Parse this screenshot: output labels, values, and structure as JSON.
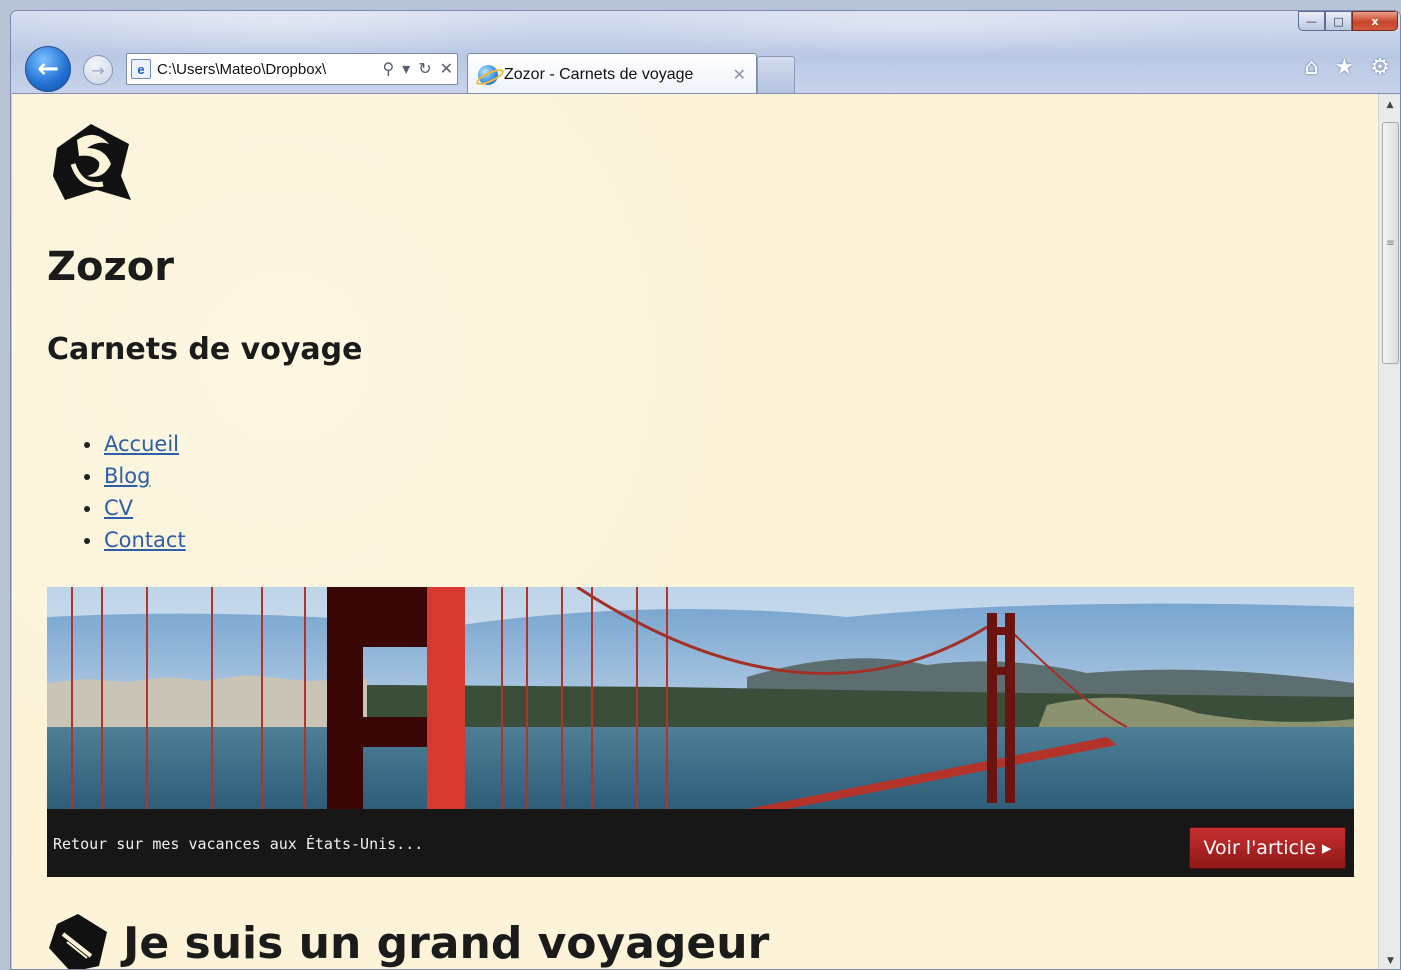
{
  "browser": {
    "address": "C:\\Users\\Mateo\\Dropbox\\",
    "tab_title": "Zozor - Carnets de voyage",
    "tab_close": "✕",
    "win_minimize": "—",
    "win_maximize": "□",
    "win_close": "x"
  },
  "site": {
    "title": "Zozor",
    "subtitle": "Carnets de voyage",
    "nav": [
      {
        "label": "Accueil"
      },
      {
        "label": "Blog"
      },
      {
        "label": "CV"
      },
      {
        "label": "Contact"
      }
    ]
  },
  "banner": {
    "caption": "Retour sur mes vacances aux États-Unis...",
    "button_label": "Voir l'article"
  },
  "section": {
    "title": "Je suis un grand voyageur"
  },
  "colors": {
    "page_bg": "#fcf3d8",
    "link": "#2c5fa8",
    "banner_button": "#b52121",
    "banner_bg": "#171717"
  }
}
